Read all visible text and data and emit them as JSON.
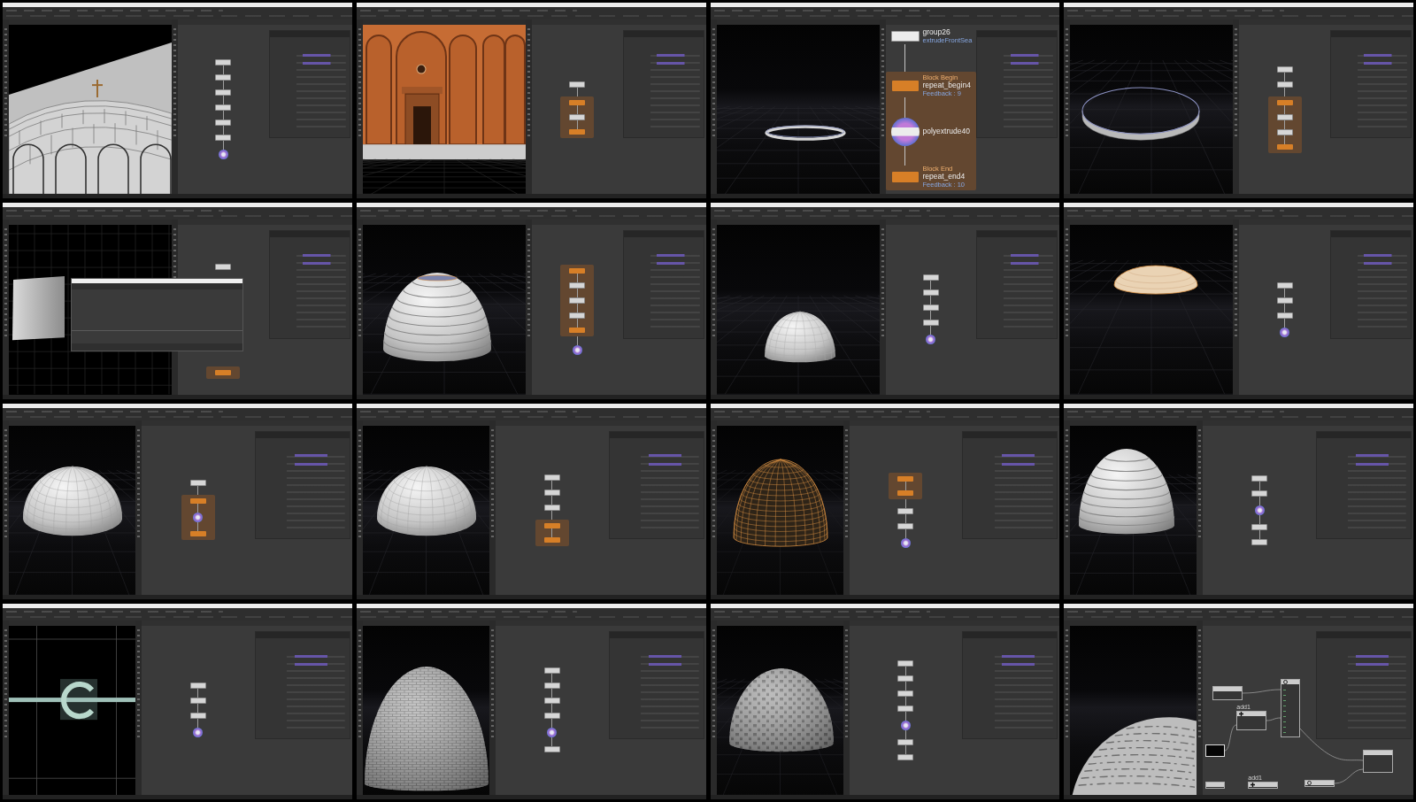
{
  "thumbnails": [
    {
      "kind": "wide",
      "dialog_open": false,
      "viewport": {
        "kind": "cathedral"
      },
      "network": {
        "kind": "chain",
        "zoomed": false,
        "nodes": [
          {
            "kind": "plain"
          },
          {
            "kind": "plain"
          },
          {
            "kind": "plain"
          },
          {
            "kind": "plain"
          },
          {
            "kind": "plain"
          },
          {
            "kind": "plain"
          },
          {
            "kind": "display"
          }
        ]
      }
    },
    {
      "kind": "wide",
      "dialog_open": false,
      "viewport": {
        "kind": "orange-wall"
      },
      "network": {
        "kind": "chain",
        "zoomed": false,
        "nodes": [
          {
            "kind": "plain"
          },
          {
            "kind": "begin"
          },
          {
            "kind": "plain"
          },
          {
            "kind": "end"
          }
        ]
      }
    },
    {
      "kind": "wide",
      "dialog_open": false,
      "viewport": {
        "kind": "ring"
      },
      "network": {
        "kind": "chain",
        "zoomed": true,
        "nodes": [
          {
            "kind": "plain",
            "label": "group26",
            "comment": "extrudeFrontSea"
          },
          {
            "kind": "begin",
            "caption": "Block Begin",
            "label": "repeat_begin4",
            "comment": "Feedback : 9"
          },
          {
            "kind": "display",
            "label": "polyextrude40"
          },
          {
            "kind": "end",
            "caption": "Block End",
            "label": "repeat_end4",
            "comment": "Feedback : 10"
          }
        ]
      }
    },
    {
      "kind": "wide",
      "dialog_open": false,
      "viewport": {
        "kind": "ring-large"
      },
      "network": {
        "kind": "chain",
        "zoomed": false,
        "nodes": [
          {
            "kind": "plain"
          },
          {
            "kind": "plain"
          },
          {
            "kind": "begin"
          },
          {
            "kind": "plain"
          },
          {
            "kind": "plain"
          },
          {
            "kind": "end"
          }
        ]
      }
    },
    {
      "kind": "wide",
      "dialog_open": true,
      "viewport": {
        "kind": "sheet"
      },
      "network": {
        "kind": "chain",
        "zoomed": false,
        "nodes": [
          {
            "kind": "plain"
          },
          {
            "kind": "end"
          }
        ]
      }
    },
    {
      "kind": "wide",
      "dialog_open": false,
      "viewport": {
        "kind": "stepped-dome"
      },
      "network": {
        "kind": "chain",
        "zoomed": false,
        "nodes": [
          {
            "kind": "begin"
          },
          {
            "kind": "plain"
          },
          {
            "kind": "plain"
          },
          {
            "kind": "plain"
          },
          {
            "kind": "end"
          },
          {
            "kind": "display"
          }
        ]
      }
    },
    {
      "kind": "wide",
      "dialog_open": false,
      "viewport": {
        "kind": "small-dome"
      },
      "network": {
        "kind": "chain",
        "zoomed": false,
        "nodes": [
          {
            "kind": "plain"
          },
          {
            "kind": "plain"
          },
          {
            "kind": "plain"
          },
          {
            "kind": "plain"
          },
          {
            "kind": "display"
          }
        ]
      }
    },
    {
      "kind": "wide",
      "dialog_open": false,
      "viewport": {
        "kind": "flat-dome"
      },
      "network": {
        "kind": "chain",
        "zoomed": false,
        "nodes": [
          {
            "kind": "plain"
          },
          {
            "kind": "plain"
          },
          {
            "kind": "plain"
          },
          {
            "kind": "display"
          }
        ]
      }
    },
    {
      "kind": "narrow",
      "dialog_open": false,
      "viewport": {
        "kind": "wide-dome"
      },
      "network": {
        "kind": "chain",
        "zoomed": false,
        "nodes": [
          {
            "kind": "plain"
          },
          {
            "kind": "begin"
          },
          {
            "kind": "display"
          },
          {
            "kind": "end"
          }
        ]
      }
    },
    {
      "kind": "narrow",
      "dialog_open": false,
      "viewport": {
        "kind": "wide-dome"
      },
      "network": {
        "kind": "chain",
        "zoomed": false,
        "nodes": [
          {
            "kind": "plain"
          },
          {
            "kind": "plain"
          },
          {
            "kind": "plain"
          },
          {
            "kind": "begin"
          },
          {
            "kind": "end"
          }
        ]
      }
    },
    {
      "kind": "narrow",
      "dialog_open": false,
      "viewport": {
        "kind": "wire-dome"
      },
      "network": {
        "kind": "chain",
        "zoomed": false,
        "nodes": [
          {
            "kind": "begin"
          },
          {
            "kind": "end"
          },
          {
            "kind": "plain"
          },
          {
            "kind": "plain"
          },
          {
            "kind": "display"
          }
        ]
      }
    },
    {
      "kind": "narrow",
      "dialog_open": false,
      "viewport": {
        "kind": "stepped-dome"
      },
      "network": {
        "kind": "chain",
        "zoomed": false,
        "nodes": [
          {
            "kind": "plain"
          },
          {
            "kind": "plain"
          },
          {
            "kind": "display"
          },
          {
            "kind": "plain"
          },
          {
            "kind": "plain"
          }
        ]
      }
    },
    {
      "kind": "narrow",
      "dialog_open": false,
      "viewport": {
        "kind": "symbol"
      },
      "network": {
        "kind": "chain",
        "zoomed": false,
        "nodes": [
          {
            "kind": "plain"
          },
          {
            "kind": "plain"
          },
          {
            "kind": "plain"
          },
          {
            "kind": "display"
          }
        ]
      }
    },
    {
      "kind": "narrow",
      "dialog_open": false,
      "viewport": {
        "kind": "brick-dome"
      },
      "network": {
        "kind": "chain",
        "zoomed": false,
        "nodes": [
          {
            "kind": "plain"
          },
          {
            "kind": "plain"
          },
          {
            "kind": "plain"
          },
          {
            "kind": "plain"
          },
          {
            "kind": "display"
          },
          {
            "kind": "plain"
          }
        ]
      }
    },
    {
      "kind": "narrow",
      "dialog_open": false,
      "viewport": {
        "kind": "patterned-dome"
      },
      "network": {
        "kind": "chain",
        "zoomed": false,
        "nodes": [
          {
            "kind": "plain"
          },
          {
            "kind": "plain"
          },
          {
            "kind": "plain"
          },
          {
            "kind": "plain"
          },
          {
            "kind": "display"
          },
          {
            "kind": "plain"
          },
          {
            "kind": "plain"
          }
        ]
      }
    },
    {
      "kind": "narrow",
      "dialog_open": false,
      "viewport": {
        "kind": "rough-sphere"
      },
      "network": {
        "kind": "vop",
        "nodes": [
          {
            "kind": "vop"
          },
          {
            "kind": "add",
            "label": "add1"
          },
          {
            "kind": "texture"
          },
          {
            "kind": "swatch"
          },
          {
            "kind": "vop"
          },
          {
            "kind": "add",
            "label": "add1"
          },
          {
            "kind": "texture"
          },
          {
            "kind": "vop"
          }
        ]
      }
    }
  ]
}
